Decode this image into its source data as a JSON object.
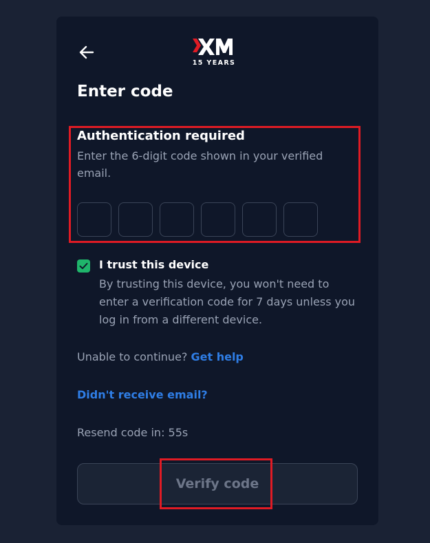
{
  "header": {
    "back_icon": "arrow-left-icon",
    "logo_years": "15 YEARS"
  },
  "title": "Enter code",
  "auth": {
    "heading": "Authentication required",
    "description": "Enter the 6-digit code shown in your verified email.",
    "code_digits": [
      "",
      "",
      "",
      "",
      "",
      ""
    ]
  },
  "trust": {
    "checked": true,
    "label": "I trust this device",
    "description": "By trusting this device, you won't need to enter a verification code for 7 days unless you log in from a different device."
  },
  "help": {
    "text": "Unable to continue?",
    "link": "Get help"
  },
  "no_email_link": "Didn't receive email?",
  "resend": "Resend code in: 55s",
  "verify_button": "Verify code",
  "colors": {
    "background": "#1a2234",
    "card": "#0f1729",
    "accent_link": "#2f7ee6",
    "checkbox": "#1fb56b",
    "highlight": "#e01b24"
  }
}
